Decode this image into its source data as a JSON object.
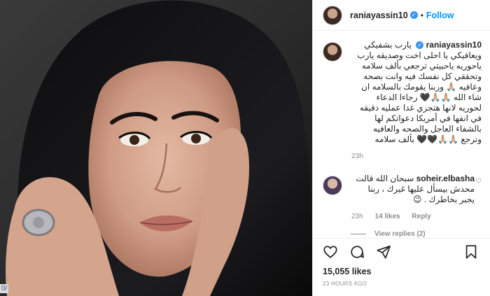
{
  "post": {
    "username": "raniayassin10",
    "separator": "•",
    "follow_label": "Follow",
    "edge_tag": "0/"
  },
  "caption": {
    "username": "raniayassin10",
    "text": "يارب بشفيكي ويعافيكي يا احلى اخت وصديقه يارب ياحوريه ياحبيتي ترجعي بألف سلامه وتحققي كل نفسك فيه وانت بصحه وعافيه 🙏🏼 وربنا يقومك بالسلامه ان شاء الله 🙏🏼🙏🏼🖤 رجاءا الدعاء لحوريه لانها هتجري غدا عمليه دقيقه في انفها في أمريكا دعواتكم لها بالشفاء العاجل والصحه والعافيه وترجع 🙏🏼🙏🏼🖤🖤 بألف سلامه",
    "time": "23h"
  },
  "comment": {
    "username": "soheir.elbasha",
    "text": "سبحان الله قالت محدش بيسأل عليها غيرك ، ربنا يجبر بخاطرك . 😉",
    "time": "23h",
    "likes": "14 likes",
    "reply": "Reply",
    "view_replies": "View replies (2)"
  },
  "footer": {
    "likes": "15,055 likes",
    "time": "23 HOURS AGO"
  },
  "icons": {
    "verified": "verified-badge-icon",
    "heart": "heart-icon",
    "comment": "comment-icon",
    "share": "share-icon",
    "save": "bookmark-icon"
  },
  "colors": {
    "accent": "#0095f6",
    "verified": "#3897f0",
    "muted": "#8e8e8e",
    "text": "#262626"
  }
}
